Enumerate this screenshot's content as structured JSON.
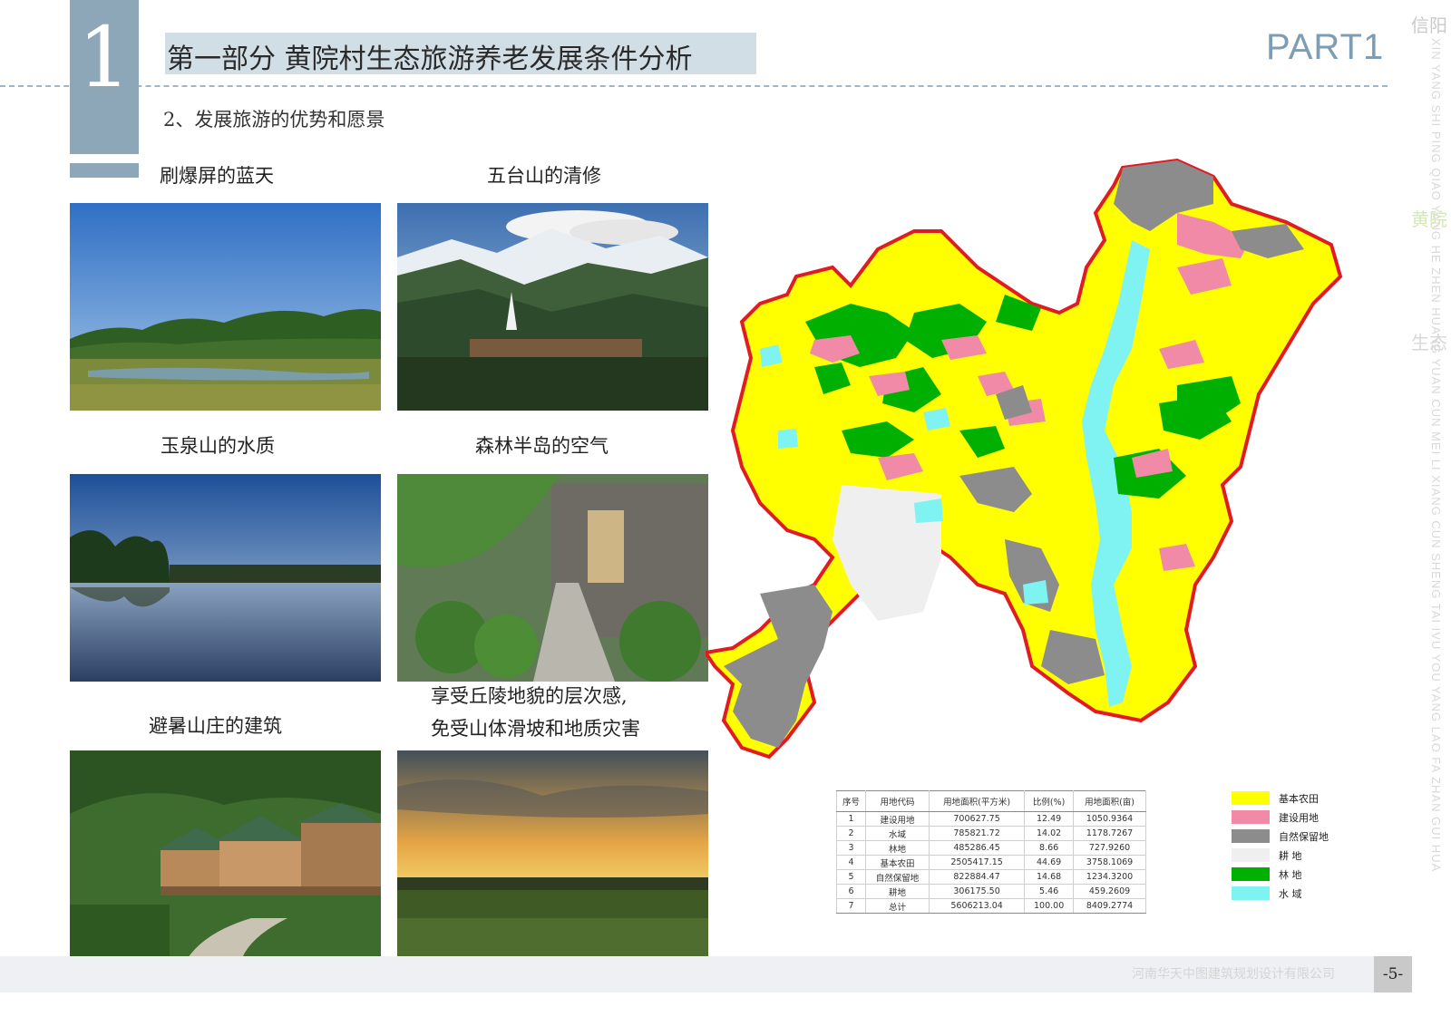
{
  "header": {
    "section_number": "1",
    "title": "第一部分  黄院村生态旅游养老发展条件分析",
    "part_label": "PART1",
    "subheading": "2、发展旅游的优势和愿景"
  },
  "side": {
    "cn_top": "信阳",
    "cn_mid": "黄院",
    "cn_low": "生态",
    "vertical_text": "XIN YANG SHI PING QIAO YANG HE ZHEN HUANG YUAN CUN MEI LI XIANG CUN SHENG TAI IVU YOU YANG LAO FA ZHAN GUI HUA"
  },
  "photos": [
    {
      "caption": "刷爆屏的蓝天"
    },
    {
      "caption": "五台山的清修"
    },
    {
      "caption": "玉泉山的水质"
    },
    {
      "caption": "森林半岛的空气"
    },
    {
      "caption": "避暑山庄的建筑"
    },
    {
      "caption_line1": "享受丘陵地貌的层次感,",
      "caption_line2": "免受山体滑坡和地质灾害"
    }
  ],
  "table": {
    "headers": [
      "序号",
      "用地代码",
      "用地面积(平方米)",
      "比例(%)",
      "用地面积(亩)"
    ],
    "rows": [
      [
        "1",
        "建设用地",
        "700627.75",
        "12.49",
        "1050.9364"
      ],
      [
        "2",
        "水域",
        "785821.72",
        "14.02",
        "1178.7267"
      ],
      [
        "3",
        "林地",
        "485286.45",
        "8.66",
        "727.9260"
      ],
      [
        "4",
        "基本农田",
        "2505417.15",
        "44.69",
        "3758.1069"
      ],
      [
        "5",
        "自然保留地",
        "822884.47",
        "14.68",
        "1234.3200"
      ],
      [
        "6",
        "耕地",
        "306175.50",
        "5.46",
        "459.2609"
      ],
      [
        "7",
        "总计",
        "5606213.04",
        "100.00",
        "8409.2774"
      ]
    ]
  },
  "legend": [
    {
      "label": "基本农田",
      "color": "#ffff00"
    },
    {
      "label": "建设用地",
      "color": "#f08aa6"
    },
    {
      "label": "自然保留地",
      "color": "#8c8c8c"
    },
    {
      "label": "耕    地",
      "color": "#efefef"
    },
    {
      "label": "林    地",
      "color": "#00b000"
    },
    {
      "label": "水    域",
      "color": "#7ff2f2"
    }
  ],
  "footer": {
    "company": "河南华天中图建筑规划设计有限公司",
    "page": "-5-"
  }
}
